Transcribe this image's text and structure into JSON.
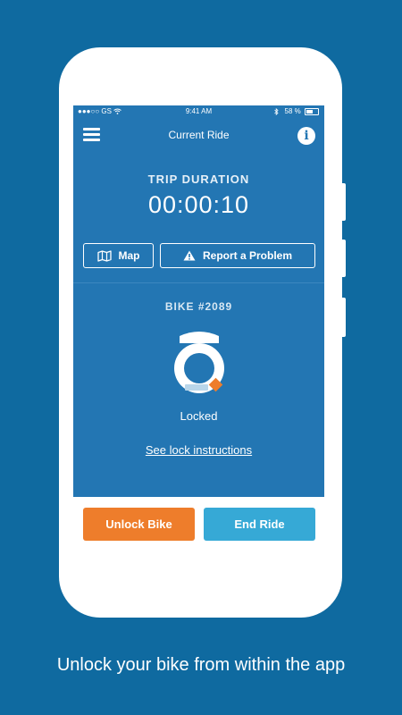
{
  "status_bar": {
    "carrier": "●●●○○ GS",
    "time": "9:41 AM",
    "battery": "58 %"
  },
  "nav": {
    "title": "Current Ride"
  },
  "trip": {
    "label": "TRIP DURATION",
    "duration": "00:00:10"
  },
  "actions": {
    "map_label": "Map",
    "report_label": "Report a Problem"
  },
  "bike": {
    "label": "BIKE #2089",
    "lock_status": "Locked",
    "lock_instructions_link": "See lock instructions"
  },
  "footer": {
    "unlock_label": "Unlock Bike",
    "end_label": "End Ride"
  },
  "caption": "Unlock your bike from within the app",
  "colors": {
    "background": "#0f6aa0",
    "screen": "#2376b3",
    "unlock_button": "#ee7d2b",
    "end_button": "#36a9d6",
    "lock_accent": "#ee7d2b"
  },
  "icons": {
    "menu": "hamburger-menu-icon",
    "info": "info-icon",
    "map": "map-icon",
    "report": "warning-triangle-icon",
    "lock": "bike-lock-icon",
    "wifi": "wifi-icon",
    "bluetooth": "bluetooth-icon",
    "battery": "battery-icon"
  }
}
